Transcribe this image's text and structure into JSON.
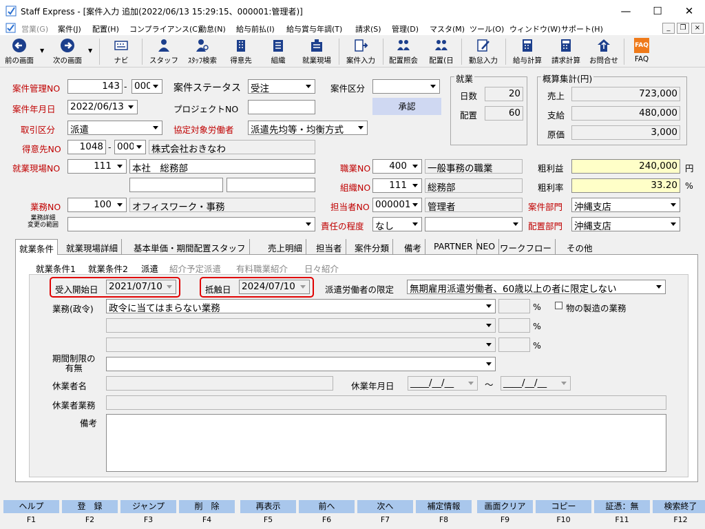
{
  "window": {
    "title": "Staff Express - [案件入力  追加(2022/06/13 15:29:15、000001:管理者)]",
    "min": "—",
    "max": "☐",
    "close": "✕"
  },
  "menu": [
    "営業(G)",
    "案件(J)",
    "配置(H)",
    "コンプライアンス(C)",
    "勤怠(N)",
    "給与前払(I)",
    "給与賞与年調(T)",
    "請求(S)",
    "管理(D)",
    "マスタ(M)",
    "ツール(O)",
    "ウィンドウ(W)",
    "サポート(H)"
  ],
  "mdi": {
    "min": "_",
    "restore": "❐",
    "close": "×"
  },
  "toolbar": {
    "prev": "前の画面",
    "next": "次の画面",
    "navi": "ナビ",
    "staff": "スタッフ",
    "staff_search": "ｽﾀｯﾌ検索",
    "client": "得意先",
    "org": "組織",
    "site": "就業現場",
    "case_input": "案件入力",
    "assign_inquiry": "配置照会",
    "assign_day": "配置(日",
    "attendance": "勤怠入力",
    "pay_calc": "給与計算",
    "bill_calc": "請求計算",
    "contact": "お問合せ",
    "faq": "FAQ",
    "faq_icon": "FAQ"
  },
  "form": {
    "case_no_label": "案件管理NO",
    "case_no": "143",
    "case_no_sep": "-",
    "case_no_sub": "000",
    "status_label": "案件ステータス",
    "status": "受注",
    "category_label": "案件区分",
    "category": "",
    "approve": "承認",
    "date_label": "案件年月日",
    "date": "2022/06/13",
    "project_label": "プロジェクトNO",
    "project": "",
    "trade_label": "取引区分",
    "trade": "派遣",
    "labor_label": "協定対象労働者",
    "labor": "派遣先均等・均衡方式",
    "client_label": "得意先NO",
    "client_no": "1048",
    "client_sep": "-",
    "client_sub": "000",
    "client_name": "株式会社おきなわ",
    "site_label": "就業現場NO",
    "site_no": "111",
    "site_name": "本社　総務部",
    "site_extra1": "",
    "site_extra2": "",
    "job_label": "職業NO",
    "job_no": "400",
    "job_name": "一般事務の職業",
    "dept_label": "組織NO",
    "dept_no": "111",
    "dept_name": "総務部",
    "work_label": "業務NO",
    "work_no": "100",
    "work_name": "オフィスワーク・事務",
    "owner_label": "担当者NO",
    "owner_no": "000001",
    "owner_name": "管理者",
    "case_dept_label": "案件部門",
    "case_dept": "沖縄支店",
    "work_detail_label1": "業務詳細",
    "work_detail_label2": "変更の範囲",
    "work_detail": "",
    "resp_label": "責任の程度",
    "resp": "なし",
    "resp2": "",
    "assign_dept_label": "配置部門",
    "assign_dept": "沖縄支店"
  },
  "employment": {
    "title": "就業",
    "days_label": "日数",
    "days": "20",
    "assign_label": "配置",
    "assign": "60"
  },
  "summary": {
    "title": "概算集計(円)",
    "sales_label": "売上",
    "sales": "723,000",
    "pay_label": "支給",
    "pay": "480,000",
    "cost_label": "原価",
    "cost": "3,000"
  },
  "profit": {
    "label": "粗利益",
    "value": "240,000",
    "unit": "円",
    "rate_label": "粗利率",
    "rate": "33.20",
    "rate_unit": "%"
  },
  "tabs": [
    "就業条件",
    "就業現場詳細",
    "基本単価・期間配置スタッフ",
    "売上明細",
    "担当者",
    "案件分類",
    "備考",
    "PARTNER",
    "NEO",
    "ワークフロー",
    "その他"
  ],
  "subtabs": [
    "就業条件1",
    "就業条件2",
    "派遣",
    "紹介予定派遣",
    "有料職業紹介",
    "日々紹介"
  ],
  "dispatch": {
    "start_label": "受入開始日",
    "start": "2021/07/10",
    "conflict_label": "抵触日",
    "conflict": "2024/07/10",
    "limit_label": "派遣労働者の限定",
    "limit": "無期雇用派遣労働者、60歳以上の者に限定しない",
    "gov_label": "業務(政令)",
    "gov1": "政令に当てはまらない業務",
    "gov2": "",
    "gov3": "",
    "pct": "%",
    "mfg_label": "物の製造の業務",
    "period_label1": "期間制限の",
    "period_label2": "有無",
    "period": "",
    "leave_name_label": "休業者名",
    "leave_name": "",
    "leave_date_label": "休業年月日",
    "leave_from": "____/__/__",
    "tilde": "～",
    "leave_to": "____/__/__",
    "leave_work_label": "休業者業務",
    "leave_work": "",
    "note_label": "備考",
    "note": ""
  },
  "fkeys": [
    {
      "label": "ヘルプ",
      "key": "F1"
    },
    {
      "label": "登　録",
      "key": "F2"
    },
    {
      "label": "ジャンプ",
      "key": "F3"
    },
    {
      "label": "削　除",
      "key": "F4"
    },
    {
      "label": "再表示",
      "key": "F5"
    },
    {
      "label": "前へ",
      "key": "F6"
    },
    {
      "label": "次へ",
      "key": "F7"
    },
    {
      "label": "補定情報",
      "key": "F8"
    },
    {
      "label": "画面クリア",
      "key": "F9"
    },
    {
      "label": "コピー",
      "key": "F10"
    },
    {
      "label": "証憑：無",
      "key": "F11"
    },
    {
      "label": "検索終了",
      "key": "F12"
    }
  ]
}
